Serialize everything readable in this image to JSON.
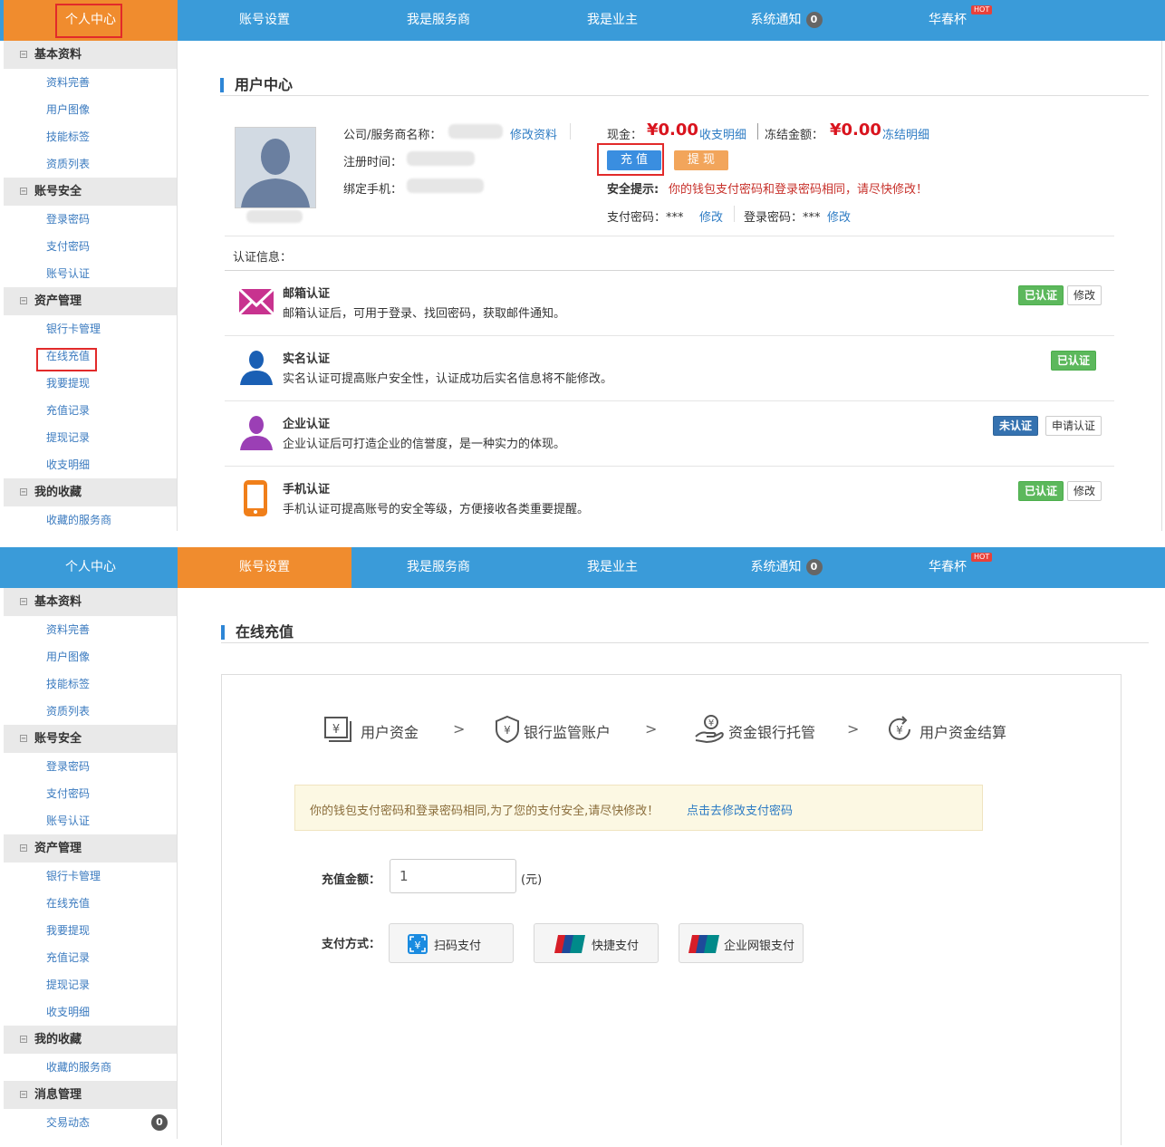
{
  "nav": {
    "tabs": [
      "个人中心",
      "账号设置",
      "我是服务商",
      "我是业主",
      "系统通知",
      "华春杯"
    ],
    "notice_count": "0",
    "hot_label": "HOT"
  },
  "sidebar": {
    "groups": [
      {
        "title": "基本资料",
        "items": [
          "资料完善",
          "用户图像",
          "技能标签",
          "资质列表"
        ]
      },
      {
        "title": "账号安全",
        "items": [
          "登录密码",
          "支付密码",
          "账号认证"
        ]
      },
      {
        "title": "资产管理",
        "items": [
          "银行卡管理",
          "在线充值",
          "我要提现",
          "充值记录",
          "提现记录",
          "收支明细"
        ]
      },
      {
        "title": "我的收藏",
        "items": [
          "收藏的服务商"
        ]
      },
      {
        "title": "消息管理",
        "items": [
          "交易动态"
        ]
      }
    ],
    "message_count": "0",
    "minus": "−"
  },
  "user_center": {
    "title": "用户中心",
    "company_label": "公司/服务商名称：",
    "edit_profile": "修改资料",
    "register_label": "注册时间：",
    "phone_label": "绑定手机：",
    "cash_label": "现金：",
    "cash_amount": "¥0.00",
    "income_detail": "收支明细",
    "frozen_label": "冻结金额：",
    "frozen_amount": "¥0.00",
    "frozen_detail": "冻结明细",
    "recharge_btn": "充 值",
    "withdraw_btn": "提 现",
    "security_tip_label": "安全提示:",
    "security_tip": "你的钱包支付密码和登录密码相同，请尽快修改！",
    "pay_pwd": "支付密码：***",
    "pay_pwd_edit": "修改",
    "login_pwd": "登录密码：***",
    "login_pwd_edit": "修改",
    "cert_info_label": "认证信息：",
    "certs": [
      {
        "title": "邮箱认证",
        "desc": "邮箱认证后，可用于登录、找回密码，获取邮件通知。",
        "status": "已认证",
        "action": "修改"
      },
      {
        "title": "实名认证",
        "desc": "实名认证可提高账户安全性，认证成功后实名信息将不能修改。",
        "status": "已认证",
        "action": ""
      },
      {
        "title": "企业认证",
        "desc": "企业认证后可打造企业的信誉度，是一种实力的体现。",
        "status": "未认证",
        "action": "申请认证"
      },
      {
        "title": "手机认证",
        "desc": "手机认证可提高账号的安全等级，方便接收各类重要提醒。",
        "status": "已认证",
        "action": "修改"
      }
    ]
  },
  "recharge": {
    "title": "在线充值",
    "steps": [
      "用户资金",
      "银行监管账户",
      "资金银行托管",
      "用户资金结算"
    ],
    "arrow": ">",
    "warning": "你的钱包支付密码和登录密码相同,为了您的支付安全,请尽快修改！",
    "warning_link": "点击去修改支付密码",
    "amount_label": "充值金额：",
    "amount_value": "1",
    "amount_unit": "(元)",
    "method_label": "支付方式：",
    "methods": [
      "扫码支付",
      "快捷支付",
      "企业网银支付"
    ]
  },
  "colors": {
    "nav_blue": "#3a9bd9",
    "active_orange": "#f08c2e",
    "link_blue": "#2e7cc4",
    "money_red": "#d9141e",
    "highlight_red": "#e22a2a"
  }
}
